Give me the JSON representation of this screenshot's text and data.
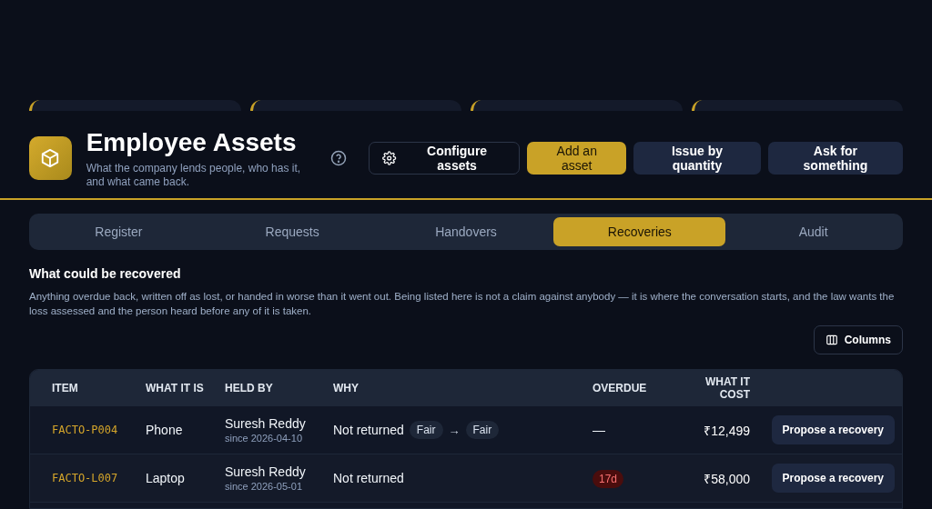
{
  "stat_cards": [
    {
      "kind": "card"
    },
    {
      "kind": "card"
    },
    {
      "kind": "card"
    },
    {
      "kind": "card"
    }
  ],
  "header": {
    "title": "Employee Assets",
    "subtitle": "What the company lends people, who has it, and what came back."
  },
  "actions": [
    {
      "label": "Configure assets",
      "kind": "outline"
    },
    {
      "label": "Add an asset",
      "kind": "primary"
    },
    {
      "label": "Issue by quantity",
      "kind": "secondary"
    },
    {
      "label": "Ask for something",
      "kind": "secondary"
    }
  ],
  "tabs": [
    {
      "label": "Register",
      "selected": false
    },
    {
      "label": "Requests",
      "selected": false
    },
    {
      "label": "Handovers",
      "selected": false
    },
    {
      "label": "Recoveries",
      "selected": true
    },
    {
      "label": "Audit",
      "selected": false
    }
  ],
  "section": {
    "title": "What could be recovered",
    "description": "Anything overdue back, written off as lost, or handed in worse than it went out. Being listed here is not a claim against anybody — it is where the conversation starts, and the law wants the loss assessed and the person heard before any of it is taken."
  },
  "columns_button": "Columns",
  "table": {
    "columns": [
      "ITEM",
      "WHAT IT IS",
      "HELD BY",
      "WHY",
      "OVERDUE",
      "WHAT IT COST"
    ],
    "rows": [
      {
        "item": "FACTO-P004",
        "what": "Phone",
        "held_by": "Suresh Reddy",
        "since": "since 2026-04-10",
        "why": "Not returned",
        "condition": {
          "from": "Fair",
          "arrow": "→",
          "to": "Fair"
        },
        "overdue": {
          "kind": "dash",
          "text": "—"
        },
        "cost": "₹12,499",
        "action": "Propose a recovery"
      },
      {
        "item": "FACTO-L007",
        "what": "Laptop",
        "held_by": "Suresh Reddy",
        "since": "since 2026-05-01",
        "why": "Not returned",
        "overdue": {
          "kind": "late",
          "text": "17d"
        },
        "cost": "₹58,000",
        "action": "Propose a recovery"
      }
    ]
  }
}
